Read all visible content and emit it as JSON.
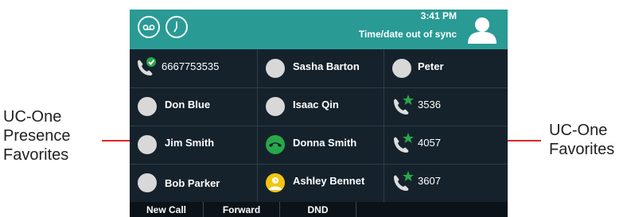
{
  "status": {
    "time": "3:41 PM",
    "sync_message": "Time/date out of sync"
  },
  "icons": {
    "voicemail": "voicemail-icon",
    "history": "clock-icon",
    "avatar": "user-avatar-icon"
  },
  "rows": [
    [
      {
        "label": "6667753535",
        "icon": "phone-check-icon"
      },
      {
        "label": "Sasha Barton",
        "icon": "presence-unknown"
      },
      {
        "label": "Peter",
        "icon": "presence-unknown"
      }
    ],
    [
      {
        "label": "Don Blue",
        "icon": "presence-unknown"
      },
      {
        "label": "Isaac Qin",
        "icon": "presence-unknown"
      },
      {
        "label": "3536",
        "icon": "favorite-star-phone-icon"
      }
    ],
    [
      {
        "label": "Jim Smith",
        "icon": "presence-unknown"
      },
      {
        "label": "Donna Smith",
        "icon": "presence-on-phone",
        "color": "#29a84a"
      },
      {
        "label": "4057",
        "icon": "favorite-star-phone-icon"
      }
    ],
    [
      {
        "label": "Bob Parker",
        "icon": "presence-unknown"
      },
      {
        "label": "Ashley Bennet",
        "icon": "presence-away",
        "color": "#f2c511"
      },
      {
        "label": "3607",
        "icon": "favorite-star-phone-icon"
      }
    ]
  ],
  "softkeys": [
    "New Call",
    "Forward",
    "DND"
  ],
  "annotations": {
    "left": [
      "UC-One",
      "Presence",
      "Favorites"
    ],
    "right": [
      "UC-One",
      "Favorites"
    ]
  },
  "colors": {
    "header": "#2a9a95",
    "screen": "#15222c",
    "callout": "#e0262b",
    "online": "#29a84a",
    "away": "#f2c511"
  }
}
